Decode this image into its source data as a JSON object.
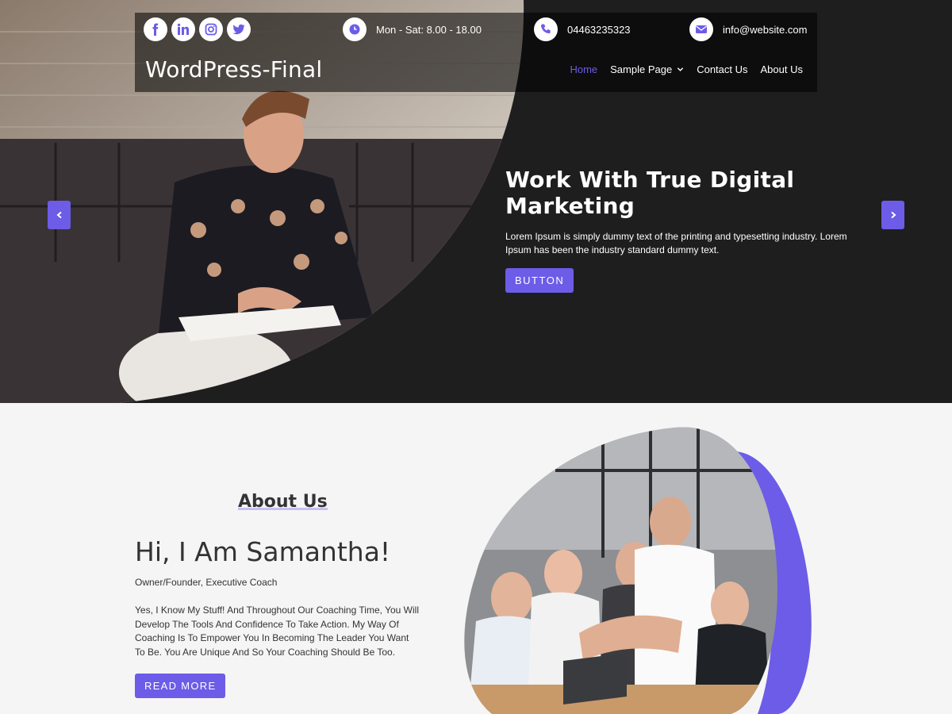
{
  "header": {
    "site_title": "WordPress-Final",
    "hours": "Mon - Sat: 8.00 - 18.00",
    "phone": "04463235323",
    "email": "info@website.com",
    "social": [
      "facebook-icon",
      "linkedin-icon",
      "instagram-icon",
      "twitter-icon"
    ],
    "nav": [
      {
        "label": "Home",
        "active": true
      },
      {
        "label": "Sample Page",
        "has_dropdown": true
      },
      {
        "label": "Contact Us"
      },
      {
        "label": "About Us"
      }
    ]
  },
  "hero": {
    "title": "Work With True Digital Marketing",
    "description": "Lorem Ipsum is simply dummy text of the printing and typesetting industry. Lorem Ipsum has been the industry standard dummy text.",
    "button_label": "BUTTON"
  },
  "about": {
    "section_heading": "About Us",
    "name": "Hi, I Am Samantha!",
    "role": "Owner/Founder, Executive Coach",
    "body": "Yes, I Know My Stuff! And Throughout Our Coaching Time, You Will Develop The Tools And Confidence To Take Action. My Way Of Coaching Is To Empower You In Becoming The Leader You Want To Be. You Are Unique And So Your Coaching Should Be Too.",
    "button_label": "READ MORE"
  },
  "colors": {
    "accent": "#6c5ce7",
    "dark": "#1e1e1f",
    "light_bg": "#f5f5f5"
  }
}
